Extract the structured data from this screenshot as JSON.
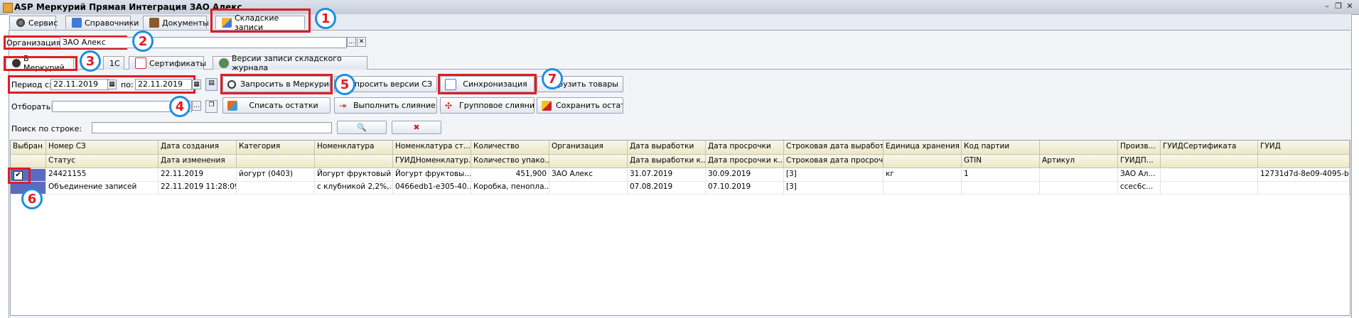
{
  "window": {
    "title": "ASP Меркурий Прямая Интеграция ЗАО Алекс"
  },
  "main_tabs": [
    {
      "label": "Сервис",
      "icon": "gear-icon"
    },
    {
      "label": "Справочники",
      "icon": "book-icon"
    },
    {
      "label": "Документы",
      "icon": "briefcase-icon"
    },
    {
      "label": "Складские записи",
      "icon": "warehouse-icon",
      "active": true
    }
  ],
  "org": {
    "label": "Организация:",
    "value": "ЗАО Алекс",
    "select_glyph": "...",
    "clear_glyph": "✕"
  },
  "sub_tabs": [
    {
      "label": "В Меркурий",
      "icon": "mercury-icon",
      "active": true
    },
    {
      "label": "1С",
      "icon": ""
    },
    {
      "label": "Сертификаты",
      "icon": "certificate-icon"
    },
    {
      "label": "Версии записи складского журнала",
      "icon": "versions-icon"
    }
  ],
  "period": {
    "from_label": "Период с:",
    "from_value": "22.11.2019",
    "to_label": "по:",
    "to_value": "22.11.2019"
  },
  "filter": {
    "label": "Отборать:",
    "value": ""
  },
  "search": {
    "label": "Поиск по строке:",
    "value": ""
  },
  "buttons": {
    "request_mercury": "Запросить в Меркурий",
    "request_versions": "Запросить версии СЗ",
    "sync": "Синхронизация",
    "load_goods": "Загрузить товары",
    "write_off": "Списать остатки",
    "merge": "Выполнить слияние",
    "group_merge": "Групповое слияние",
    "save_rest": "Сохранить остатки"
  },
  "callouts": [
    "1",
    "2",
    "3",
    "4",
    "5",
    "6",
    "7"
  ],
  "grid": {
    "headers_row1": [
      "Выбран",
      "Номер СЗ",
      "Дата создания",
      "Категория",
      "Номенклатура",
      "Номенклатура ст...",
      "Количество",
      "Организация",
      "Дата выработки",
      "Дата просрочки",
      "Строковая дата выработ...",
      "Единица хранения",
      "Код партии",
      "",
      "Произв...",
      "ГУИДСертификата",
      "ГУИД"
    ],
    "headers_row2": [
      "",
      "Статус",
      "Дата изменения",
      "",
      "",
      "ГУИДНоменклатур...",
      "Количество упако...",
      "",
      "Дата выработки к...",
      "Дата просрочки к...",
      "Строковая дата просроч...",
      "",
      "GTIN",
      "Артикул",
      "ГУИДП...",
      "",
      ""
    ],
    "row1": [
      "",
      "24421155",
      "22.11.2019",
      "йогурт (0403)",
      "Йогурт фруктовый",
      "Йогурт фруктовы...",
      "451,900",
      "ЗАО Алекс",
      "31.07.2019",
      "30.09.2019",
      "[3]",
      "кг",
      "1",
      "",
      "ЗАО Ал...",
      "",
      "12731d7d-8e09-4095-b7..."
    ],
    "row1_line2": [
      "",
      "Объединение записей",
      "22.11.2019 11:28:09",
      "",
      "с клубникой 2,2%,...",
      "0466edb1-e305-40...",
      "Коробка, пенопла...",
      "",
      "07.08.2019",
      "07.10.2019",
      "[3]",
      "",
      "",
      "",
      "ccec6c...",
      "",
      ""
    ]
  }
}
